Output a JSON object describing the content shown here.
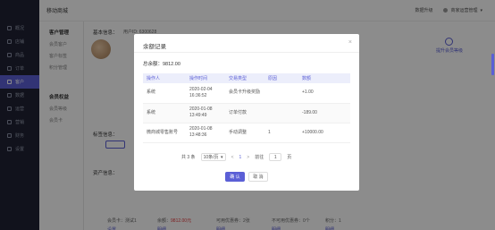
{
  "app": {
    "brand": "移动商城"
  },
  "header": {
    "upgrade_link": "数据升级",
    "user_name": "商家运营管理"
  },
  "sidebar": {
    "items": [
      {
        "label": "概况"
      },
      {
        "label": "店铺"
      },
      {
        "label": "商品"
      },
      {
        "label": "订单"
      },
      {
        "label": "客户"
      },
      {
        "label": "数据"
      },
      {
        "label": "运营"
      },
      {
        "label": "营销"
      },
      {
        "label": "财务"
      },
      {
        "label": "设置"
      }
    ]
  },
  "subnav": {
    "group1": "客户管理",
    "links1": [
      "会员客户",
      "客户标签",
      "积分管理"
    ],
    "group2": "会员权益",
    "links2": [
      "会员等级",
      "会员卡"
    ]
  },
  "content": {
    "basic_title": "基本信息：",
    "user_id": "用户ID: 6300628",
    "upgrade_label": "提升会员等级",
    "tag_label": "标签信息：",
    "tag_value": "测试",
    "stats_title": "资产信息：",
    "member_card": "会员卡：测试1",
    "member_link": "设置",
    "balance_label": "余额：",
    "balance_value": "9812.00元",
    "balance_link": "明细",
    "coupons": "可用优惠券：2张",
    "coupons_link": "明细",
    "expired_coupons": "不可用优惠券：0个",
    "expired_link": "明细",
    "points": "积分：1",
    "points_link": "明细"
  },
  "modal": {
    "title": "余额记录",
    "close": "×",
    "total_label": "总余额：9812.00",
    "columns": [
      "操作人",
      "操作时间",
      "交易类型",
      "原因",
      "数额"
    ],
    "rows": [
      {
        "operator": "系统",
        "time": "2020-02-04 16:36:52",
        "type": "会员卡升级奖励",
        "reason": "",
        "amount": "+1.00"
      },
      {
        "operator": "系统",
        "time": "2020-01-08 13:49:49",
        "type": "订单付款",
        "reason": "",
        "amount": "-189.00"
      },
      {
        "operator": "微商城零售账号",
        "time": "2020-01-08 13:48:36",
        "type": "手动调整",
        "reason": "1",
        "amount": "+10000.00"
      }
    ],
    "pager": {
      "total": "共 3 条",
      "page_size": "10条/页",
      "prev": "<",
      "current_page": "1",
      "next": ">",
      "goto_label": "前往",
      "goto_value": "1",
      "page_unit": "页"
    },
    "ok_label": "确 认",
    "cancel_label": "取 消"
  },
  "colors": {
    "accent": "#5b5fd6",
    "sidebar_bg": "#1f2233",
    "danger": "#e4393c"
  }
}
